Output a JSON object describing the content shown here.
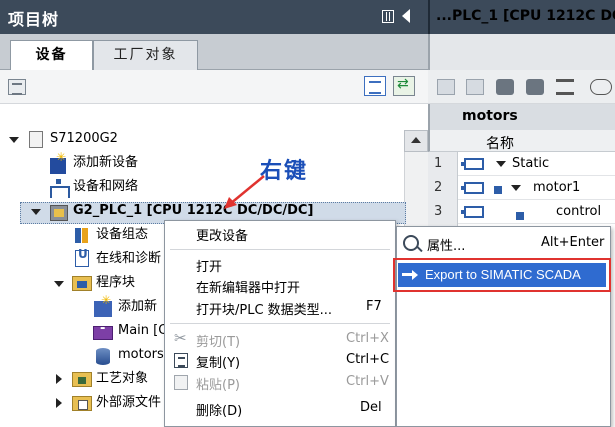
{
  "left_panel": {
    "title": "项目树",
    "tabs": [
      {
        "label": "设备"
      },
      {
        "label": "工厂对象"
      }
    ]
  },
  "tree": {
    "items": [
      {
        "label": "S71200G2"
      },
      {
        "label": "添加新设备"
      },
      {
        "label": "设备和网络"
      },
      {
        "label": "G2_PLC_1 [CPU 1212C DC/DC/DC]"
      },
      {
        "label": "设备组态"
      },
      {
        "label": "在线和诊断"
      },
      {
        "label": "程序块"
      },
      {
        "label": "添加新"
      },
      {
        "label": "Main [O"
      },
      {
        "label": "motors"
      },
      {
        "label": "工艺对象"
      },
      {
        "label": "外部源文件"
      }
    ]
  },
  "annotation": {
    "text": "右键"
  },
  "right_panel": {
    "title": "...PLC_1 [CPU 1212C DC/",
    "block_name": "motors",
    "column_header": "名称",
    "rows": [
      {
        "num": "1",
        "name": "Static"
      },
      {
        "num": "2",
        "name": "motor1"
      },
      {
        "num": "3",
        "name": "control"
      }
    ]
  },
  "context_menu": {
    "items": [
      {
        "label": "更改设备",
        "shortcut": ""
      },
      {
        "label": "打开",
        "shortcut": ""
      },
      {
        "label": "在新编辑器中打开",
        "shortcut": ""
      },
      {
        "label": "打开块/PLC 数据类型...",
        "shortcut": "F7"
      },
      {
        "label": "剪切(T)",
        "shortcut": "Ctrl+X"
      },
      {
        "label": "复制(Y)",
        "shortcut": "Ctrl+C"
      },
      {
        "label": "粘贴(P)",
        "shortcut": "Ctrl+V"
      },
      {
        "label": "删除(D)",
        "shortcut": "Del"
      }
    ]
  },
  "submenu": {
    "items": [
      {
        "label": "属性...",
        "shortcut": "Alt+Enter"
      },
      {
        "label": "Export to SIMATIC SCADA",
        "shortcut": ""
      }
    ]
  },
  "colors": {
    "titlebar": "#3c4a5a",
    "selection": "#2f6bd0",
    "highlight_border": "#e0332f",
    "annotation": "#1b4fb8"
  }
}
